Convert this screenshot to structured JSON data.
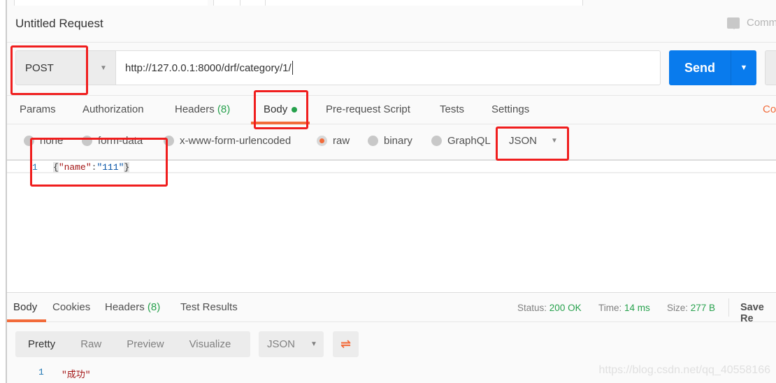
{
  "request": {
    "title": "Untitled Request",
    "comments_label": "Comm",
    "method": "POST",
    "url": "http://127.0.0.1:8000/drf/category/1/",
    "send_label": "Send",
    "tabs": [
      {
        "label": "Params"
      },
      {
        "label": "Authorization"
      },
      {
        "label": "Headers",
        "count": "(8)"
      },
      {
        "label": "Body",
        "active": true
      },
      {
        "label": "Pre-request Script"
      },
      {
        "label": "Tests"
      },
      {
        "label": "Settings"
      }
    ],
    "cookies_label": "Co",
    "body_options": [
      "none",
      "form-data",
      "x-www-form-urlencoded",
      "raw",
      "binary",
      "GraphQL"
    ],
    "selected_body_option": "raw",
    "format": "JSON",
    "editor": {
      "line_number": "1",
      "open": "{",
      "key": "\"name\"",
      "colon": ":",
      "value": "\"111\"",
      "close": "}"
    }
  },
  "response": {
    "tabs": [
      {
        "label": "Body",
        "active": true
      },
      {
        "label": "Cookies"
      },
      {
        "label": "Headers",
        "count": "(8)"
      },
      {
        "label": "Test Results"
      }
    ],
    "status_label": "Status:",
    "status": "200 OK",
    "time_label": "Time:",
    "time": "14 ms",
    "size_label": "Size:",
    "size": "277 B",
    "save_label": "Save Re",
    "views": [
      "Pretty",
      "Raw",
      "Preview",
      "Visualize"
    ],
    "active_view": "Pretty",
    "format": "JSON",
    "line_number": "1",
    "content": "\"成功\""
  },
  "watermark": "https://blog.csdn.net/qq_40558166",
  "colors": {
    "accent": "#f26b3a",
    "send": "#097bed",
    "success": "#26a14c",
    "annotation": "#f01e1e"
  }
}
